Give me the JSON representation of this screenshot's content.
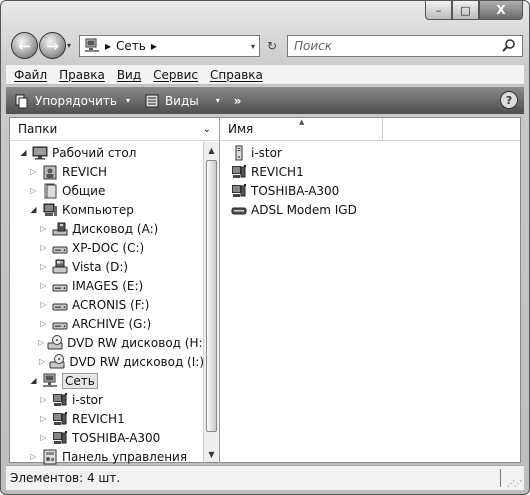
{
  "window": {
    "buttons": {
      "minimize": "–",
      "maximize": "□",
      "close": "X"
    }
  },
  "nav": {
    "back_glyph": "←",
    "forward_glyph": "→",
    "history_glyph": "▾",
    "address": {
      "separator": "▸",
      "location": "Сеть",
      "trail": "▸",
      "dropdown": "▾"
    },
    "refresh_glyph": "↻",
    "search_placeholder": "Поиск"
  },
  "menu": [
    "Файл",
    "Правка",
    "Вид",
    "Сервис",
    "Справка"
  ],
  "toolbar": {
    "organize": "Упорядочить",
    "views": "Виды",
    "dropdown": "▾",
    "more": "»",
    "help": "?"
  },
  "nav_pane": {
    "title": "Папки",
    "title_dropdown": "⌄",
    "tree": [
      {
        "label": "Рабочий стол",
        "arrow": "◢",
        "icon": "desktop-icon",
        "level": 0
      },
      {
        "label": "REVICH",
        "arrow": "▷",
        "icon": "user-folder-icon",
        "level": 1
      },
      {
        "label": "Общие",
        "arrow": "▷",
        "icon": "folder-icon",
        "level": 1
      },
      {
        "label": "Компьютер",
        "arrow": "◢",
        "icon": "computer-icon",
        "level": 1
      },
      {
        "label": "Дисковод (A:)",
        "arrow": "▷",
        "icon": "floppy-drive-icon",
        "level": 2
      },
      {
        "label": "XP-DOC (C:)",
        "arrow": "▷",
        "icon": "hard-drive-icon",
        "level": 2
      },
      {
        "label": "Vista (D:)",
        "arrow": "▷",
        "icon": "system-drive-icon",
        "level": 2
      },
      {
        "label": "IMAGES (E:)",
        "arrow": "▷",
        "icon": "hard-drive-icon",
        "level": 2
      },
      {
        "label": "ACRONIS (F:)",
        "arrow": "▷",
        "icon": "hard-drive-icon",
        "level": 2
      },
      {
        "label": "ARCHIVE (G:)",
        "arrow": "▷",
        "icon": "hard-drive-icon",
        "level": 2
      },
      {
        "label": "DVD RW дисковод (H:)",
        "arrow": "▷",
        "icon": "dvd-drive-icon",
        "level": 2
      },
      {
        "label": "DVD RW дисковод (I:)",
        "arrow": "▷",
        "icon": "dvd-drive-icon",
        "level": 2
      },
      {
        "label": "Сеть",
        "arrow": "◢",
        "icon": "network-icon",
        "level": 1,
        "selected": true
      },
      {
        "label": "i-stor",
        "arrow": "▷",
        "icon": "network-computer-icon",
        "level": 2
      },
      {
        "label": "REVICH1",
        "arrow": "▷",
        "icon": "network-computer-icon",
        "level": 2
      },
      {
        "label": "TOSHIBA-A300",
        "arrow": "▷",
        "icon": "network-computer-icon",
        "level": 2
      },
      {
        "label": "Панель управления",
        "arrow": "▷",
        "icon": "control-panel-icon",
        "level": 1
      }
    ],
    "scroll_up": "▲",
    "scroll_down": "▼"
  },
  "file_pane": {
    "column_name": "Имя",
    "sort_indicator": "▲",
    "items": [
      {
        "name": "i-stor",
        "icon": "server-icon"
      },
      {
        "name": "REVICH1",
        "icon": "network-computer-icon"
      },
      {
        "name": "TOSHIBA-A300",
        "icon": "network-computer-icon"
      },
      {
        "name": "ADSL Modem IGD",
        "icon": "modem-icon"
      }
    ]
  },
  "status": {
    "text": "Элементов: 4 шт.",
    "grip": "⋰⋰"
  }
}
